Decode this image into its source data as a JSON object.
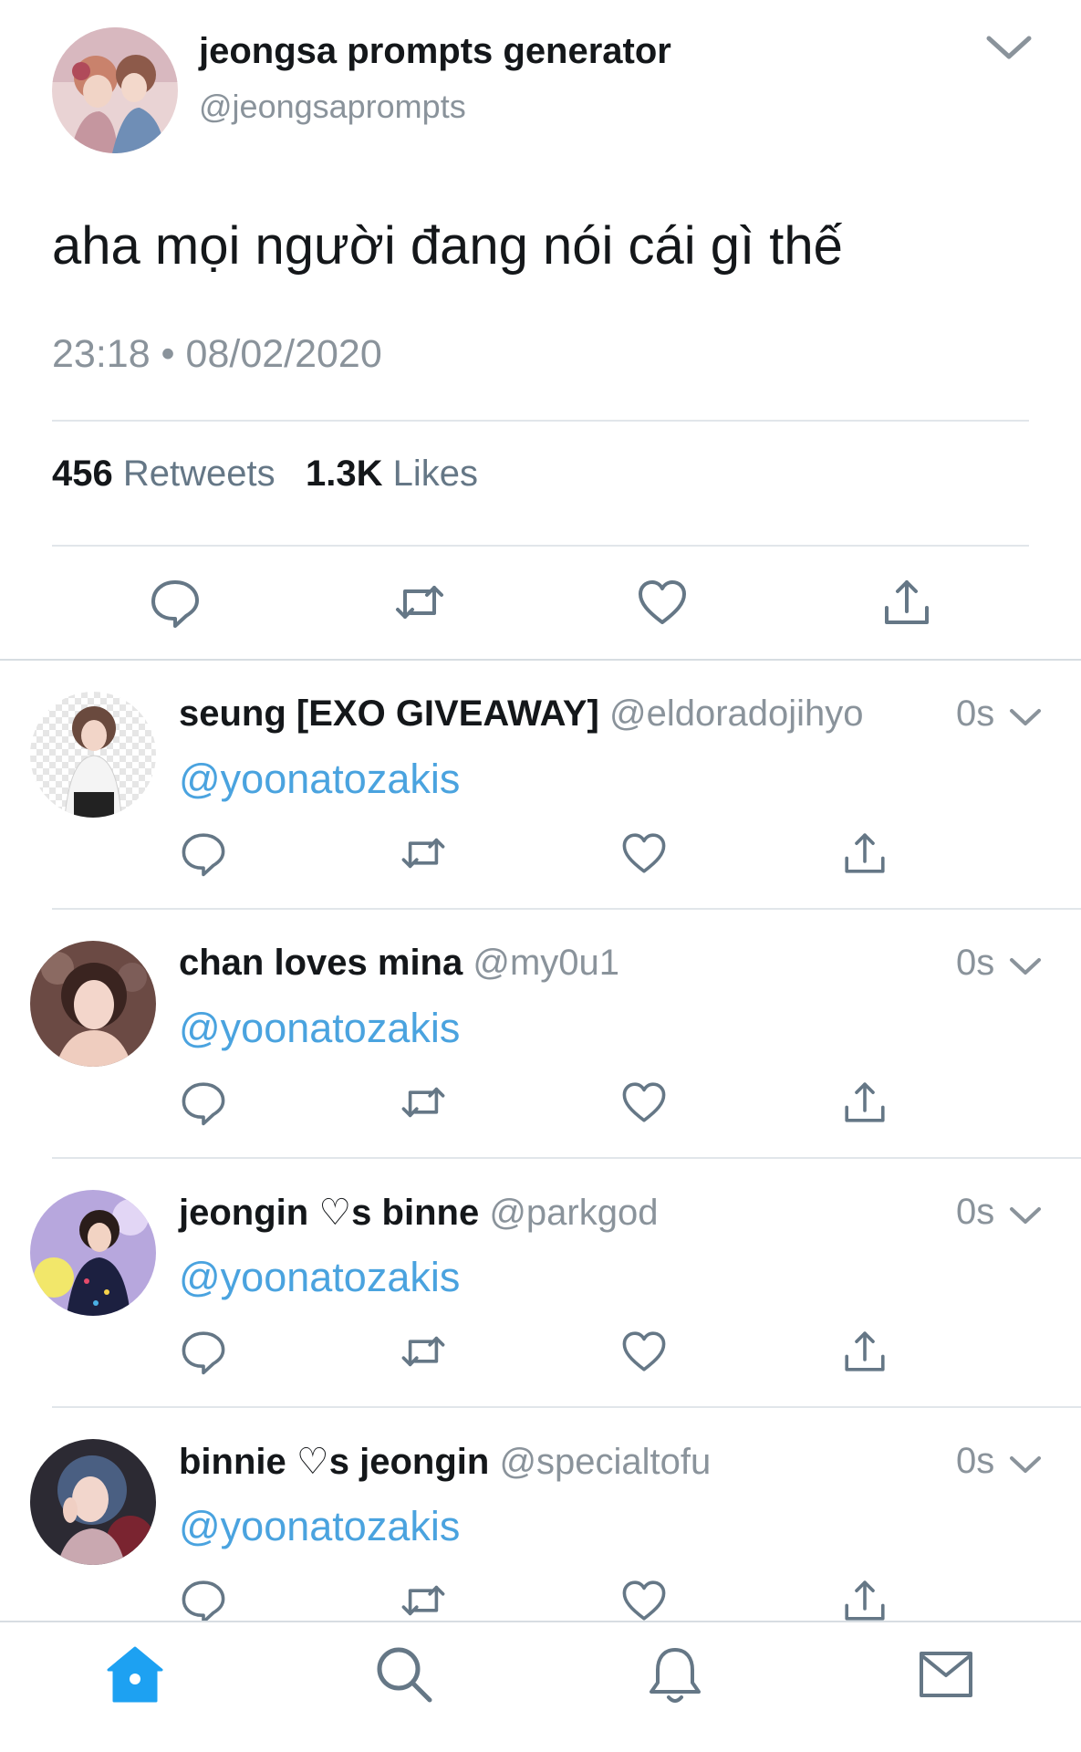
{
  "tweet": {
    "author_name": "jeongsa prompts generator",
    "author_handle": "@jeongsaprompts",
    "text": "aha mọi người đang nói cái gì thế",
    "timestamp": "23:18 • 08/02/2020",
    "retweets_count": "456",
    "retweets_label": "Retweets",
    "likes_count": "1.3K",
    "likes_label": "Likes",
    "icons": [
      "reply-icon",
      "retweet-icon",
      "like-icon",
      "share-icon",
      "chevron-down-icon"
    ]
  },
  "replies": [
    {
      "name": "seung [EXO GIVEAWAY]",
      "handle": "@eldoradojihyo",
      "time": "0s",
      "mention": "@yoonatozakis"
    },
    {
      "name": "chan loves mina",
      "handle": "@my0u1",
      "time": "0s",
      "mention": "@yoonatozakis"
    },
    {
      "name": "jeongin ♡s binne",
      "handle": "@parkgod",
      "time": "0s",
      "mention": "@yoonatozakis"
    },
    {
      "name": "binnie ♡s jeongin",
      "handle": "@specialtofu",
      "time": "0s",
      "mention": "@yoonatozakis"
    }
  ],
  "tabbar": {
    "tabs": [
      "home-icon",
      "search-icon",
      "notifications-icon",
      "messages-icon"
    ],
    "active": "home-icon"
  },
  "colors": {
    "accent": "#1da1f2",
    "mention": "#4aa3df",
    "secondary_text": "#8a939b",
    "icon_gray": "#657786"
  }
}
